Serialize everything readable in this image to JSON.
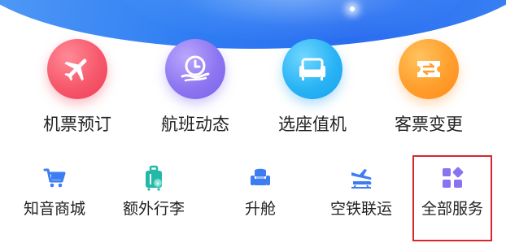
{
  "top_services": [
    {
      "label": "机票预订",
      "icon": "airplane-icon",
      "color": "#f6586b"
    },
    {
      "label": "航班动态",
      "icon": "clock-hand-icon",
      "color": "#8d76f0"
    },
    {
      "label": "选座值机",
      "icon": "seat-icon",
      "color": "#2ab4f5"
    },
    {
      "label": "客票变更",
      "icon": "ticket-exchange-icon",
      "color": "#ff9e2c"
    }
  ],
  "secondary_services": [
    {
      "label": "知音商城",
      "icon": "shopping-cart-icon"
    },
    {
      "label": "额外行李",
      "icon": "luggage-icon"
    },
    {
      "label": "升舱",
      "icon": "seat-upgrade-icon"
    },
    {
      "label": "空铁联运",
      "icon": "air-rail-icon"
    },
    {
      "label": "全部服务",
      "icon": "all-services-grid-icon"
    }
  ],
  "highlight_color": "#d9262c"
}
